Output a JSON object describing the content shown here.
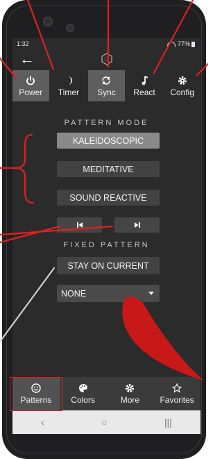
{
  "status": {
    "time": "1:32",
    "battery": "77%"
  },
  "tabs": [
    {
      "label": "Power",
      "icon": "power-icon",
      "active": true
    },
    {
      "label": "Timer",
      "icon": "moon-icon",
      "active": false
    },
    {
      "label": "Sync",
      "icon": "sync-icon",
      "active": true
    },
    {
      "label": "React",
      "icon": "music-note-icon",
      "active": false
    },
    {
      "label": "Config",
      "icon": "gear-icon",
      "active": false
    }
  ],
  "pattern_mode": {
    "title": "PATTERN MODE",
    "options": [
      "KALEIDOSCOPIC",
      "MEDITATIVE",
      "SOUND REACTIVE"
    ],
    "selected": "KALEIDOSCOPIC"
  },
  "navigation": {
    "prev_icon": "skip-previous-icon",
    "next_icon": "skip-next-icon"
  },
  "fixed_pattern": {
    "title": "FIXED PATTERN",
    "stay_label": "STAY ON CURRENT",
    "dropdown_value": "NONE"
  },
  "bottom_nav": [
    {
      "label": "Patterns",
      "icon": "smiley-icon",
      "active": true
    },
    {
      "label": "Colors",
      "icon": "palette-icon",
      "active": false
    },
    {
      "label": "More",
      "icon": "gear-icon",
      "active": false
    },
    {
      "label": "Favorites",
      "icon": "star-icon",
      "active": false
    }
  ],
  "system_nav": {
    "back": "‹",
    "home": "○",
    "recents": "|||"
  },
  "colors": {
    "accent_active": "#5e5e5e",
    "button": "#434343",
    "button_selected": "#8a8a8a",
    "annotation": "#e02020"
  }
}
